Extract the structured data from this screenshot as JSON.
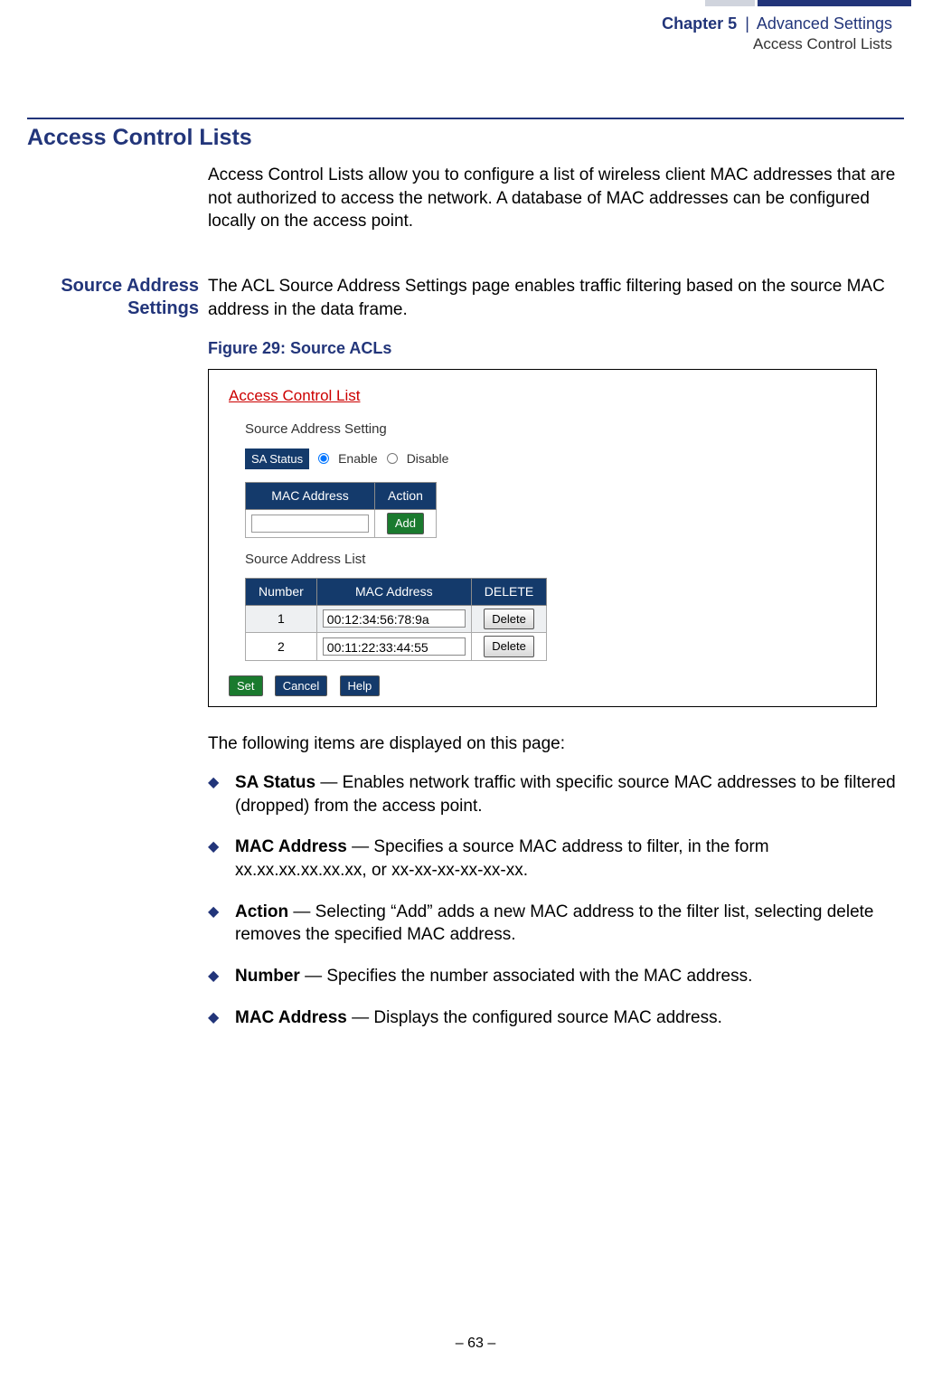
{
  "header": {
    "chapter_bold": "Chapter 5",
    "sep": "|",
    "chapter_light": "Advanced Settings",
    "sub": "Access Control Lists"
  },
  "section": {
    "title": "Access Control Lists",
    "intro": "Access Control Lists allow you to configure a list of wireless client MAC addresses that are not authorized to access the network. A database of MAC addresses can be configured locally on the access point."
  },
  "subsection": {
    "side_title_line1": "Source Address",
    "side_title_line2": "Settings",
    "body": "The ACL Source Address Settings page enables traffic filtering based on the source MAC address in the data frame.",
    "figure_caption": "Figure 29:  Source ACLs"
  },
  "figure_ui": {
    "title": "Access Control List",
    "sa_heading": "Source Address Setting",
    "sa_label": "SA Status",
    "enable": "Enable",
    "disable": "Disable",
    "mac_col": "MAC Address",
    "action_col": "Action",
    "add_btn": "Add",
    "list_heading": "Source Address List",
    "num_col": "Number",
    "mac_col2": "MAC Address",
    "del_col": "DELETE",
    "rows": [
      {
        "n": "1",
        "mac": "00:12:34:56:78:9a",
        "btn": "Delete"
      },
      {
        "n": "2",
        "mac": "00:11:22:33:44:55",
        "btn": "Delete"
      }
    ],
    "btn_set": "Set",
    "btn_cancel": "Cancel",
    "btn_help": "Help"
  },
  "items_intro": "The following items are displayed on this page:",
  "bullets": [
    {
      "term": "SA Status",
      "desc": " — Enables network traffic with specific source MAC addresses to be filtered (dropped) from the access point."
    },
    {
      "term": "MAC Address",
      "desc": " — Specifies a source MAC address to filter, in the form xx.xx.xx.xx.xx.xx, or xx-xx-xx-xx-xx-xx."
    },
    {
      "term": "Action",
      "desc": " — Selecting “Add” adds a new MAC address to the filter list, selecting delete removes the specified MAC address."
    },
    {
      "term": "Number",
      "desc": " — Specifies the number associated with the MAC address."
    },
    {
      "term": "MAC Address",
      "desc": " — Displays the configured source MAC address."
    }
  ],
  "footer": "–  63  –"
}
